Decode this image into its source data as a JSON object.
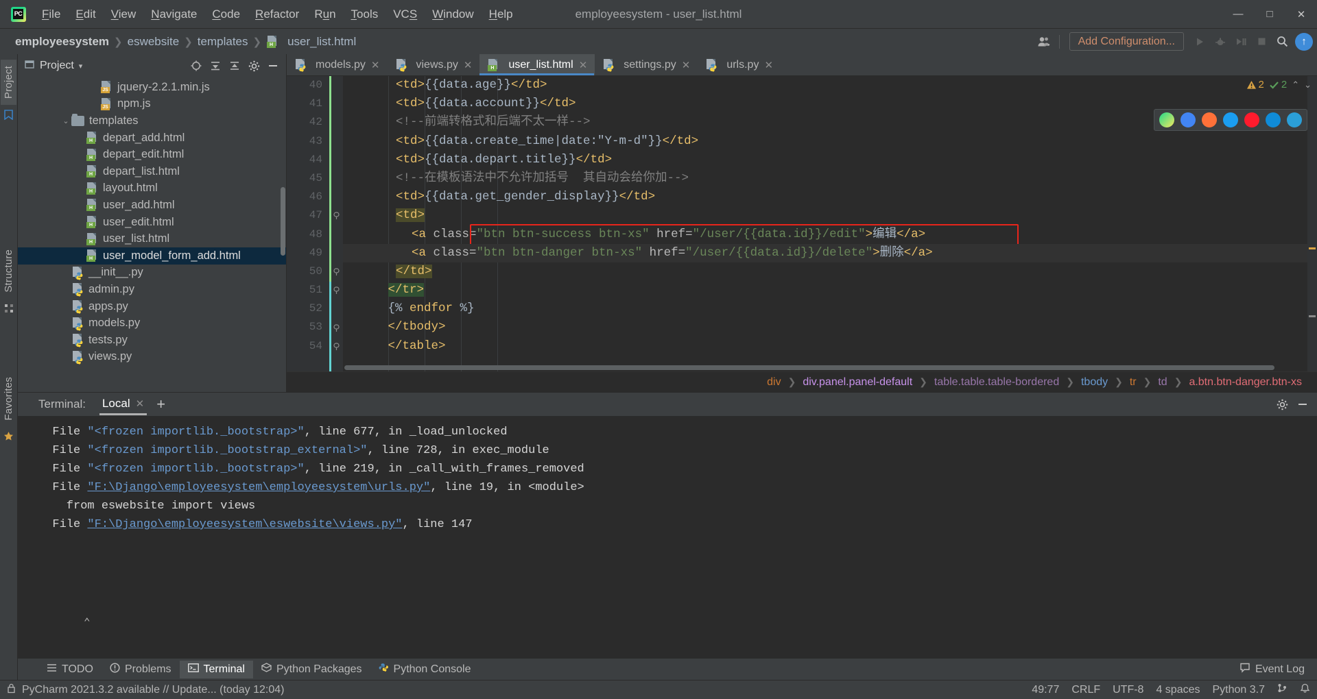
{
  "window": {
    "title": "employeesystem - user_list.html",
    "logo": "pycharm-logo",
    "minimize": "—",
    "maximize": "□",
    "close": "✕"
  },
  "menu": [
    {
      "label": "File",
      "mnemonic": "F"
    },
    {
      "label": "Edit",
      "mnemonic": "E"
    },
    {
      "label": "View",
      "mnemonic": "V"
    },
    {
      "label": "Navigate",
      "mnemonic": "N"
    },
    {
      "label": "Code",
      "mnemonic": "C"
    },
    {
      "label": "Refactor",
      "mnemonic": "R"
    },
    {
      "label": "Run",
      "mnemonic": "u"
    },
    {
      "label": "Tools",
      "mnemonic": "T"
    },
    {
      "label": "VCS",
      "mnemonic": "S"
    },
    {
      "label": "Window",
      "mnemonic": "W"
    },
    {
      "label": "Help",
      "mnemonic": "H"
    }
  ],
  "navbar": {
    "crumbs": [
      "employeesystem",
      "eswebsite",
      "templates",
      "user_list.html"
    ],
    "separator": "❯",
    "add_configuration": "Add Configuration...",
    "run_icon": "run-icon",
    "debug_icon": "debug-icon",
    "coverage_icon": "run-coverage-icon",
    "stop_icon": "stop-icon",
    "search_icon": "search-everywhere-icon",
    "user_icon": "user-accounts-icon",
    "update_badge": "↑"
  },
  "left_strip": {
    "project_tab": "Project",
    "structure_tab": "Structure",
    "favorites_tab": "Favorites",
    "bookmark_icon": "bookmark-icon",
    "star_icon": "star-icon",
    "structure_icon": "structure-icon"
  },
  "project_panel": {
    "title": "Project",
    "chevron": "▾",
    "icons": [
      "locate-icon",
      "collapse-all-icon",
      "expand-all-icon",
      "settings-icon",
      "hide-icon"
    ],
    "tree": [
      {
        "label": "jquery-2.2.1.min.js",
        "type": "js",
        "indent": 4,
        "twist": "",
        "selected": false
      },
      {
        "label": "npm.js",
        "type": "js",
        "indent": 4,
        "twist": "",
        "selected": false
      },
      {
        "label": "templates",
        "type": "folder",
        "indent": 2,
        "twist": "⌄",
        "selected": false
      },
      {
        "label": "depart_add.html",
        "type": "html",
        "indent": 3,
        "twist": "",
        "selected": false
      },
      {
        "label": "depart_edit.html",
        "type": "html",
        "indent": 3,
        "twist": "",
        "selected": false
      },
      {
        "label": "depart_list.html",
        "type": "html",
        "indent": 3,
        "twist": "",
        "selected": false
      },
      {
        "label": "layout.html",
        "type": "html",
        "indent": 3,
        "twist": "",
        "selected": false
      },
      {
        "label": "user_add.html",
        "type": "html",
        "indent": 3,
        "twist": "",
        "selected": false
      },
      {
        "label": "user_edit.html",
        "type": "html",
        "indent": 3,
        "twist": "",
        "selected": false
      },
      {
        "label": "user_list.html",
        "type": "html",
        "indent": 3,
        "twist": "",
        "selected": false
      },
      {
        "label": "user_model_form_add.html",
        "type": "html",
        "indent": 3,
        "twist": "",
        "selected": true
      },
      {
        "label": "__init__.py",
        "type": "py",
        "indent": 2,
        "twist": "",
        "selected": false
      },
      {
        "label": "admin.py",
        "type": "py",
        "indent": 2,
        "twist": "",
        "selected": false
      },
      {
        "label": "apps.py",
        "type": "py",
        "indent": 2,
        "twist": "",
        "selected": false
      },
      {
        "label": "models.py",
        "type": "py",
        "indent": 2,
        "twist": "",
        "selected": false
      },
      {
        "label": "tests.py",
        "type": "py",
        "indent": 2,
        "twist": "",
        "selected": false
      },
      {
        "label": "views.py",
        "type": "py",
        "indent": 2,
        "twist": "",
        "selected": false
      }
    ]
  },
  "editor": {
    "tabs": [
      {
        "label": "models.py",
        "type": "py",
        "active": false
      },
      {
        "label": "views.py",
        "type": "py",
        "active": false
      },
      {
        "label": "user_list.html",
        "type": "html",
        "active": true
      },
      {
        "label": "settings.py",
        "type": "py",
        "active": false
      },
      {
        "label": "urls.py",
        "type": "py",
        "active": false
      }
    ],
    "tab_close": "✕",
    "inspection": {
      "warning_icon": "warning-triangle-icon",
      "warning_count": "2",
      "ok_icon": "checkmark-icon",
      "ok_count": "2",
      "up_chevron": "⌃",
      "down_chevron": "⌄"
    },
    "browser_icons": [
      "pycharm-browser-icon",
      "chrome-icon",
      "firefox-icon",
      "safari-icon",
      "opera-icon",
      "edge-icon",
      "explorer-icon"
    ],
    "first_line_number": 40,
    "lines": [
      {
        "n": 40,
        "indent": 6,
        "segments": [
          {
            "t": "tag",
            "v": "<td>"
          },
          {
            "t": "var",
            "v": "{{data.age}}"
          },
          {
            "t": "tag",
            "v": "</td>"
          }
        ]
      },
      {
        "n": 41,
        "indent": 6,
        "segments": [
          {
            "t": "tag",
            "v": "<td>"
          },
          {
            "t": "var",
            "v": "{{data.account}}"
          },
          {
            "t": "tag",
            "v": "</td>"
          }
        ]
      },
      {
        "n": 42,
        "indent": 6,
        "segments": [
          {
            "t": "com",
            "v": "<!--前端转格式和后端不太一样-->"
          }
        ]
      },
      {
        "n": 43,
        "indent": 6,
        "segments": [
          {
            "t": "tag",
            "v": "<td>"
          },
          {
            "t": "var",
            "v": "{{data.create_time|date:\"Y-m-d\"}}"
          },
          {
            "t": "tag",
            "v": "</td>"
          }
        ]
      },
      {
        "n": 44,
        "indent": 6,
        "segments": [
          {
            "t": "tag",
            "v": "<td>"
          },
          {
            "t": "var",
            "v": "{{data.depart.title}}"
          },
          {
            "t": "tag",
            "v": "</td>"
          }
        ]
      },
      {
        "n": 45,
        "indent": 6,
        "segments": [
          {
            "t": "com",
            "v": "<!--在模板语法中不允许加括号  其自动会给你加-->"
          }
        ]
      },
      {
        "n": 46,
        "indent": 6,
        "segments": [
          {
            "t": "tag",
            "v": "<td>"
          },
          {
            "t": "var",
            "v": "{{data.get_gender_display}}"
          },
          {
            "t": "tag",
            "v": "</td>"
          }
        ]
      },
      {
        "n": 47,
        "indent": 6,
        "segments": [
          {
            "t": "tag",
            "v": "<td>",
            "hl": "olive"
          }
        ]
      },
      {
        "n": 48,
        "indent": 8,
        "boxed": true,
        "segments": [
          {
            "t": "tag",
            "v": "<a "
          },
          {
            "t": "attr",
            "v": "class="
          },
          {
            "t": "str",
            "v": "\"btn btn-success btn-xs\""
          },
          {
            "t": "attr",
            "v": " href="
          },
          {
            "t": "str",
            "v": "\"/user/{{data.id}}/edit\""
          },
          {
            "t": "tag",
            "v": ">"
          },
          {
            "t": "txt",
            "v": "编辑"
          },
          {
            "t": "tag",
            "v": "</a>"
          }
        ]
      },
      {
        "n": 49,
        "indent": 8,
        "current": true,
        "segments": [
          {
            "t": "tag",
            "v": "<a "
          },
          {
            "t": "attr",
            "v": "class="
          },
          {
            "t": "str",
            "v": "\"btn btn-danger btn-xs\""
          },
          {
            "t": "attr",
            "v": " href="
          },
          {
            "t": "str",
            "v": "\"/user/{{data.id}}/delete\""
          },
          {
            "t": "tag",
            "v": ">"
          },
          {
            "t": "txt",
            "v": "删除"
          },
          {
            "t": "tag",
            "v": "</a>"
          }
        ]
      },
      {
        "n": 50,
        "indent": 6,
        "segments": [
          {
            "t": "tag",
            "v": "</td>",
            "hl": "olive"
          }
        ]
      },
      {
        "n": 51,
        "indent": 5,
        "segments": [
          {
            "t": "tag",
            "v": "</tr>",
            "hl": "green"
          }
        ]
      },
      {
        "n": 52,
        "indent": 5,
        "segments": [
          {
            "t": "var",
            "v": "{% "
          },
          {
            "t": "endfor",
            "v": "endfor"
          },
          {
            "t": "var",
            "v": " %}"
          }
        ]
      },
      {
        "n": 53,
        "indent": 5,
        "segments": [
          {
            "t": "tag",
            "v": "</tbody>"
          }
        ]
      },
      {
        "n": 54,
        "indent": 5,
        "segments": [
          {
            "t": "tag",
            "v": "</table>"
          }
        ]
      }
    ],
    "breadcrumbs": [
      {
        "label": "div",
        "color": "#cc7832"
      },
      {
        "label": "div.panel.panel-default",
        "color": "#c792ea"
      },
      {
        "label": "table.table.table-bordered",
        "color": "#9876aa"
      },
      {
        "label": "tbody",
        "color": "#6a9ad0"
      },
      {
        "label": "tr",
        "color": "#cc7832"
      },
      {
        "label": "td",
        "color": "#9876aa"
      },
      {
        "label": "a.btn.btn-danger.btn-xs",
        "color": "#e06c75"
      }
    ],
    "breadcrumb_sep": "❯"
  },
  "terminal": {
    "label": "Terminal:",
    "tab": "Local",
    "tab_close": "✕",
    "add": "+",
    "settings_icon": "gear-icon",
    "hide_icon": "hide-icon",
    "scroll_up": "⌃",
    "lines": [
      [
        {
          "t": "plain",
          "v": "  File "
        },
        {
          "t": "str",
          "v": "\"<frozen importlib._bootstrap>\""
        },
        {
          "t": "plain",
          "v": ", line 677, in _load_unlocked"
        }
      ],
      [
        {
          "t": "plain",
          "v": "  File "
        },
        {
          "t": "str",
          "v": "\"<frozen importlib._bootstrap_external>\""
        },
        {
          "t": "plain",
          "v": ", line 728, in exec_module"
        }
      ],
      [
        {
          "t": "plain",
          "v": "  File "
        },
        {
          "t": "str",
          "v": "\"<frozen importlib._bootstrap>\""
        },
        {
          "t": "plain",
          "v": ", line 219, in _call_with_frames_removed"
        }
      ],
      [
        {
          "t": "plain",
          "v": "  File "
        },
        {
          "t": "link",
          "v": "\"F:\\Django\\employeesystem\\employeesystem\\urls.py\""
        },
        {
          "t": "plain",
          "v": ", line 19, in <module>"
        }
      ],
      [
        {
          "t": "plain",
          "v": "    from eswebsite import views"
        }
      ],
      [
        {
          "t": "plain",
          "v": "  File "
        },
        {
          "t": "link",
          "v": "\"F:\\Django\\employeesystem\\eswebsite\\views.py\""
        },
        {
          "t": "plain",
          "v": ", line 147"
        }
      ]
    ]
  },
  "tool_tabs": [
    {
      "label": "TODO",
      "icon": "todo-icon",
      "active": false
    },
    {
      "label": "Problems",
      "icon": "problems-icon",
      "active": false
    },
    {
      "label": "Terminal",
      "icon": "terminal-icon",
      "active": true
    },
    {
      "label": "Python Packages",
      "icon": "packages-icon",
      "active": false
    },
    {
      "label": "Python Console",
      "icon": "console-icon",
      "active": false
    }
  ],
  "event_log": {
    "label": "Event Log",
    "icon": "balloon-icon"
  },
  "statusbar": {
    "update_notice": "PyCharm 2021.3.2 available // Update... (today 12:04)",
    "lock_icon": "readonly-lock-icon",
    "caret_position": "49:77",
    "line_separator": "CRLF",
    "encoding": "UTF-8",
    "indent": "4 spaces",
    "interpreter": "Python 3.7",
    "branch_icon": "git-branch-icon",
    "notify_icon": "notification-icon"
  },
  "colors": {
    "bg_chrome": "#3c3f41",
    "bg_editor": "#2b2b2b",
    "accent_tab": "#4a88c7",
    "selection": "#0d293e",
    "tag": "#e8bf6a",
    "string": "#6a8759",
    "comment": "#808080",
    "link": "#6a9ad0",
    "red_box": "#e8251b",
    "warning": "#d9a343",
    "ok": "#5a9e5a"
  }
}
